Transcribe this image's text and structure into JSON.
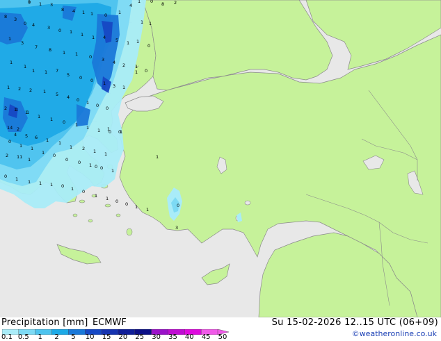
{
  "title": "Precipitation [mm]",
  "model": "ECMWF",
  "datetime": "Su 15-02-2026 12..15 UTC (06+09)",
  "credit": "©weatheronline.co.uk",
  "colors": {
    "sea": "#e8e8e8",
    "land": "#c6f29a",
    "land_outline": "#8a8a8a"
  },
  "legend": {
    "ticks": [
      "0.1",
      "0.5",
      "1",
      "2",
      "5",
      "10",
      "15",
      "20",
      "25",
      "30",
      "35",
      "40",
      "45",
      "50"
    ],
    "colors": [
      "#a9ecf8",
      "#7ddaf4",
      "#4dc3ee",
      "#1da9e6",
      "#1a78d8",
      "#1648c4",
      "#1633b0",
      "#101e98",
      "#0c0f86",
      "#9a12c8",
      "#bf0cd2",
      "#de0ade",
      "#f05ae8"
    ]
  },
  "contour_labels": [
    "0",
    "1",
    "3",
    "8",
    "4",
    "1",
    "1",
    "0",
    "1",
    "4",
    "1",
    "0",
    "8",
    "2",
    "1",
    "1",
    "1",
    "0",
    "8",
    "3",
    "0",
    "4",
    "3",
    "0",
    "1",
    "1",
    "1",
    "4",
    "5",
    "1",
    "1",
    "3",
    "7",
    "8",
    "1",
    "1",
    "0",
    "3",
    "4",
    "2",
    "1",
    "1",
    "1",
    "1",
    "1",
    "7",
    "5",
    "0",
    "0",
    "1",
    "3",
    "1",
    "1",
    "0",
    "1",
    "2",
    "2",
    "1",
    "5",
    "4",
    "0",
    "1",
    "0",
    "0",
    "2",
    "1",
    "1",
    "1",
    "1",
    "0",
    "1",
    "1",
    "1",
    "0",
    "1",
    "4",
    "5",
    "6",
    "1",
    "1",
    "1",
    "2",
    "1",
    "1",
    "2",
    "11",
    "1",
    "1",
    "1",
    "14",
    "2",
    "0",
    "1",
    "1",
    "1",
    "0",
    "0",
    "0",
    "1",
    "0",
    "1",
    "0",
    "1",
    "1",
    "1",
    "1",
    "0",
    "1",
    "0",
    "1",
    "1",
    "0",
    "0",
    "1",
    "1",
    "1",
    "1",
    "0",
    "0",
    "3",
    "0",
    "1"
  ]
}
